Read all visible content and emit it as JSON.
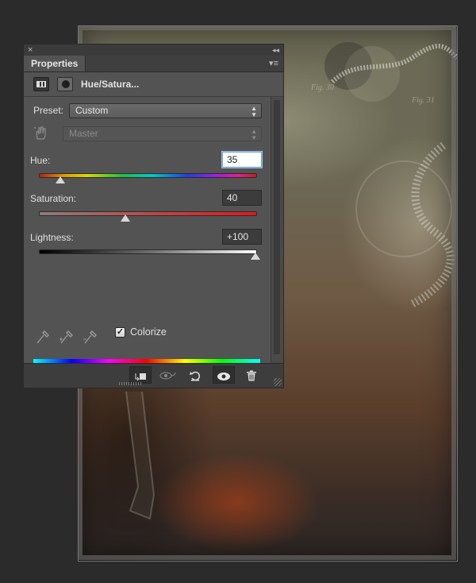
{
  "canvas": {
    "annotations": [
      "Fig. 30",
      "Fig. 31"
    ]
  },
  "panel": {
    "close_glyph": "×",
    "collapse_glyph": "◂◂",
    "tab_label": "Properties",
    "menu_glyph": "▾≡",
    "adjustment_title": "Hue/Satura...",
    "preset_label": "Preset:",
    "preset_value": "Custom",
    "channel_value": "Master",
    "hue": {
      "label": "Hue:",
      "value": "35",
      "position": 0.1
    },
    "saturation": {
      "label": "Saturation:",
      "value": "40",
      "position": 0.4
    },
    "lightness": {
      "label": "Lightness:",
      "value": "+100",
      "position": 1.0
    },
    "colorize": {
      "label": "Colorize",
      "checked": true,
      "check_glyph": "✓"
    },
    "bottom_buttons": {
      "clip_icon": "clip-to-layer-icon",
      "view_previous_icon": "view-previous-state-icon",
      "reset_icon": "reset-icon",
      "visibility_icon": "eye-icon",
      "delete_icon": "trash-icon"
    }
  },
  "colors": {
    "panel_bg": "#535353",
    "workspace_bg": "#2b2b2b",
    "active_input": "#ffffff"
  }
}
